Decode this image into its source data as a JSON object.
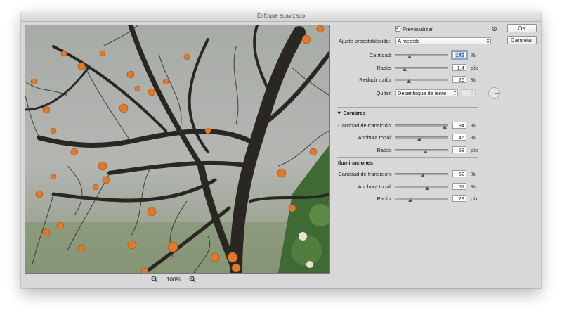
{
  "window": {
    "title": "Enfoque suavizado"
  },
  "zoom": {
    "out_icon": "zoom-out-icon",
    "value": "100%",
    "in_icon": "zoom-in-icon"
  },
  "buttons": {
    "ok": "OK",
    "cancel": "Cancelar"
  },
  "preview_checkbox": {
    "label": "Previsualizar",
    "checked": true
  },
  "settings_icon": "gear-icon",
  "preset": {
    "label": "Ajuste preestablecido:",
    "value": "A medida"
  },
  "main": {
    "amount": {
      "label": "Cantidad:",
      "value": "142",
      "unit": "%",
      "level": 0.28
    },
    "radius": {
      "label": "Radio:",
      "value": "1,4",
      "unit": "píx",
      "level": 0.18
    },
    "noise": {
      "label": "Reducir ruido:",
      "value": "26",
      "unit": "%",
      "level": 0.26
    }
  },
  "remove": {
    "label": "Quitar:",
    "value": "Desenfoque de lente",
    "angle_value": "0",
    "angle_unit": "°"
  },
  "shadows": {
    "title": "Sombras",
    "fade": {
      "label": "Cantidad de transición:",
      "value": "94",
      "unit": "%",
      "level": 0.94
    },
    "tonal": {
      "label": "Anchura tonal:",
      "value": "46",
      "unit": "%",
      "level": 0.46
    },
    "radius": {
      "label": "Radio:",
      "value": "58",
      "unit": "píx",
      "level": 0.58
    }
  },
  "highlights": {
    "title": "Iluminaciones",
    "fade": {
      "label": "Cantidad de transición:",
      "value": "52",
      "unit": "%",
      "level": 0.52
    },
    "tonal": {
      "label": "Anchura tonal:",
      "value": "61",
      "unit": "%",
      "level": 0.61
    },
    "radius": {
      "label": "Radio:",
      "value": "29",
      "unit": "píx",
      "level": 0.29
    }
  }
}
